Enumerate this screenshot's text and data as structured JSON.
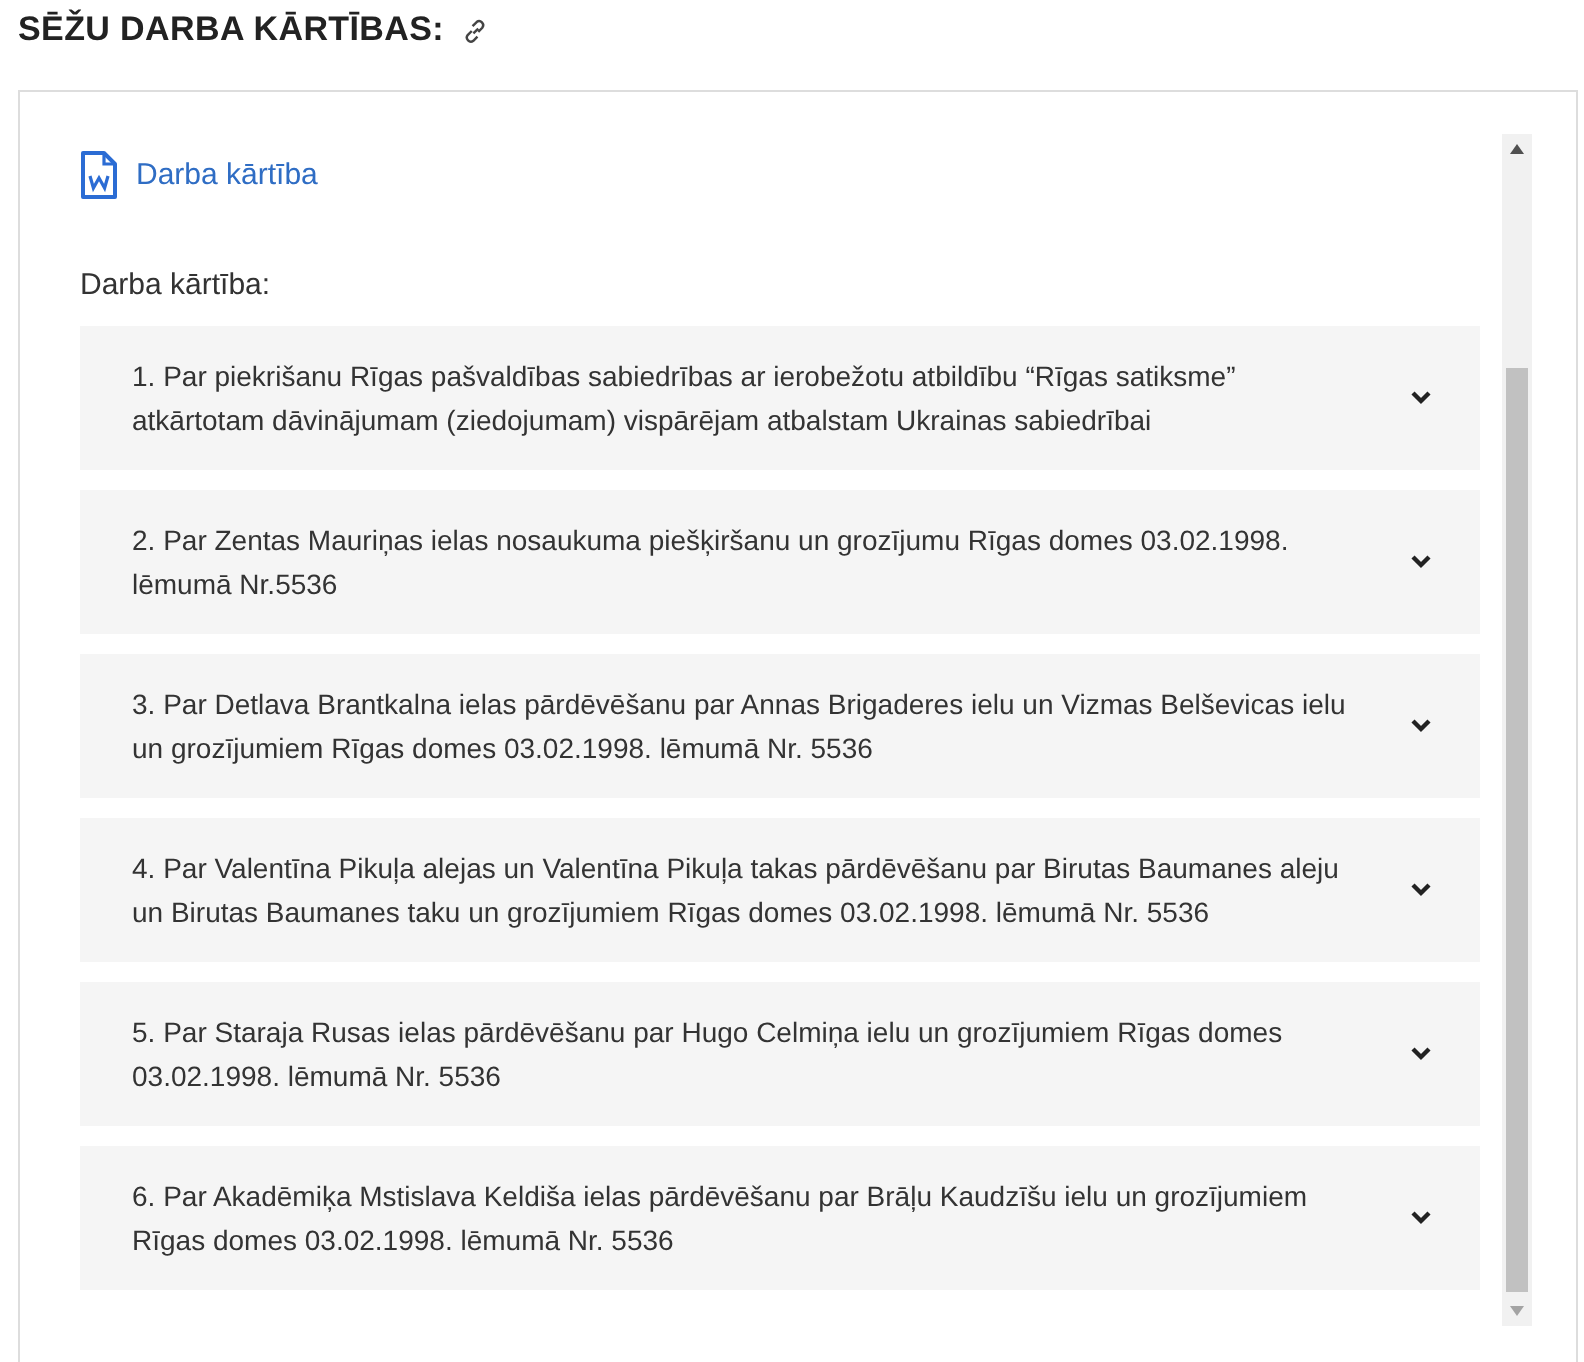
{
  "heading": "SĒŽU DARBA KĀRTĪBAS:",
  "document_link": "Darba kārtība",
  "agenda_label": "Darba kārtība:",
  "items": [
    {
      "text": "1. Par piekrišanu Rīgas pašvaldības sabiedrības ar ierobežotu atbildību “Rīgas satiksme” atkārtotam dāvinājumam (ziedojumam) vispārējam atbalstam Ukrainas sabiedrībai",
      "expanded": false
    },
    {
      "text": "2. Par Zentas Mauriņas ielas nosaukuma piešķiršanu un grozījumu Rīgas domes 03.02.1998. lēmumā Nr.5536",
      "expanded": false
    },
    {
      "text": "3. Par Detlava Brantkalna ielas pārdēvēšanu par Annas Brigaderes ielu un Vizmas Belševicas ielu un grozījumiem Rīgas domes 03.02.1998. lēmumā Nr. 5536",
      "expanded": false
    },
    {
      "text": "4. Par Valentīna Pikuļa alejas un Valentīna Pikuļa takas pārdēvēšanu par Birutas Baumanes aleju un Birutas Baumanes taku un grozījumiem Rīgas domes 03.02.1998. lēmumā Nr. 5536",
      "expanded": false
    },
    {
      "text": "5. Par Staraja Rusas ielas pārdēvēšanu par Hugo Celmiņa ielu un grozījumiem Rīgas domes 03.02.1998. lēmumā Nr. 5536",
      "expanded": false
    },
    {
      "text": "6. Par Akadēmiķa Mstislava Keldiša ielas pārdēvēšanu par Brāļu Kaudzīšu ielu un grozījumiem Rīgas domes 03.02.1998. lēmumā Nr. 5536",
      "expanded": false
    }
  ]
}
